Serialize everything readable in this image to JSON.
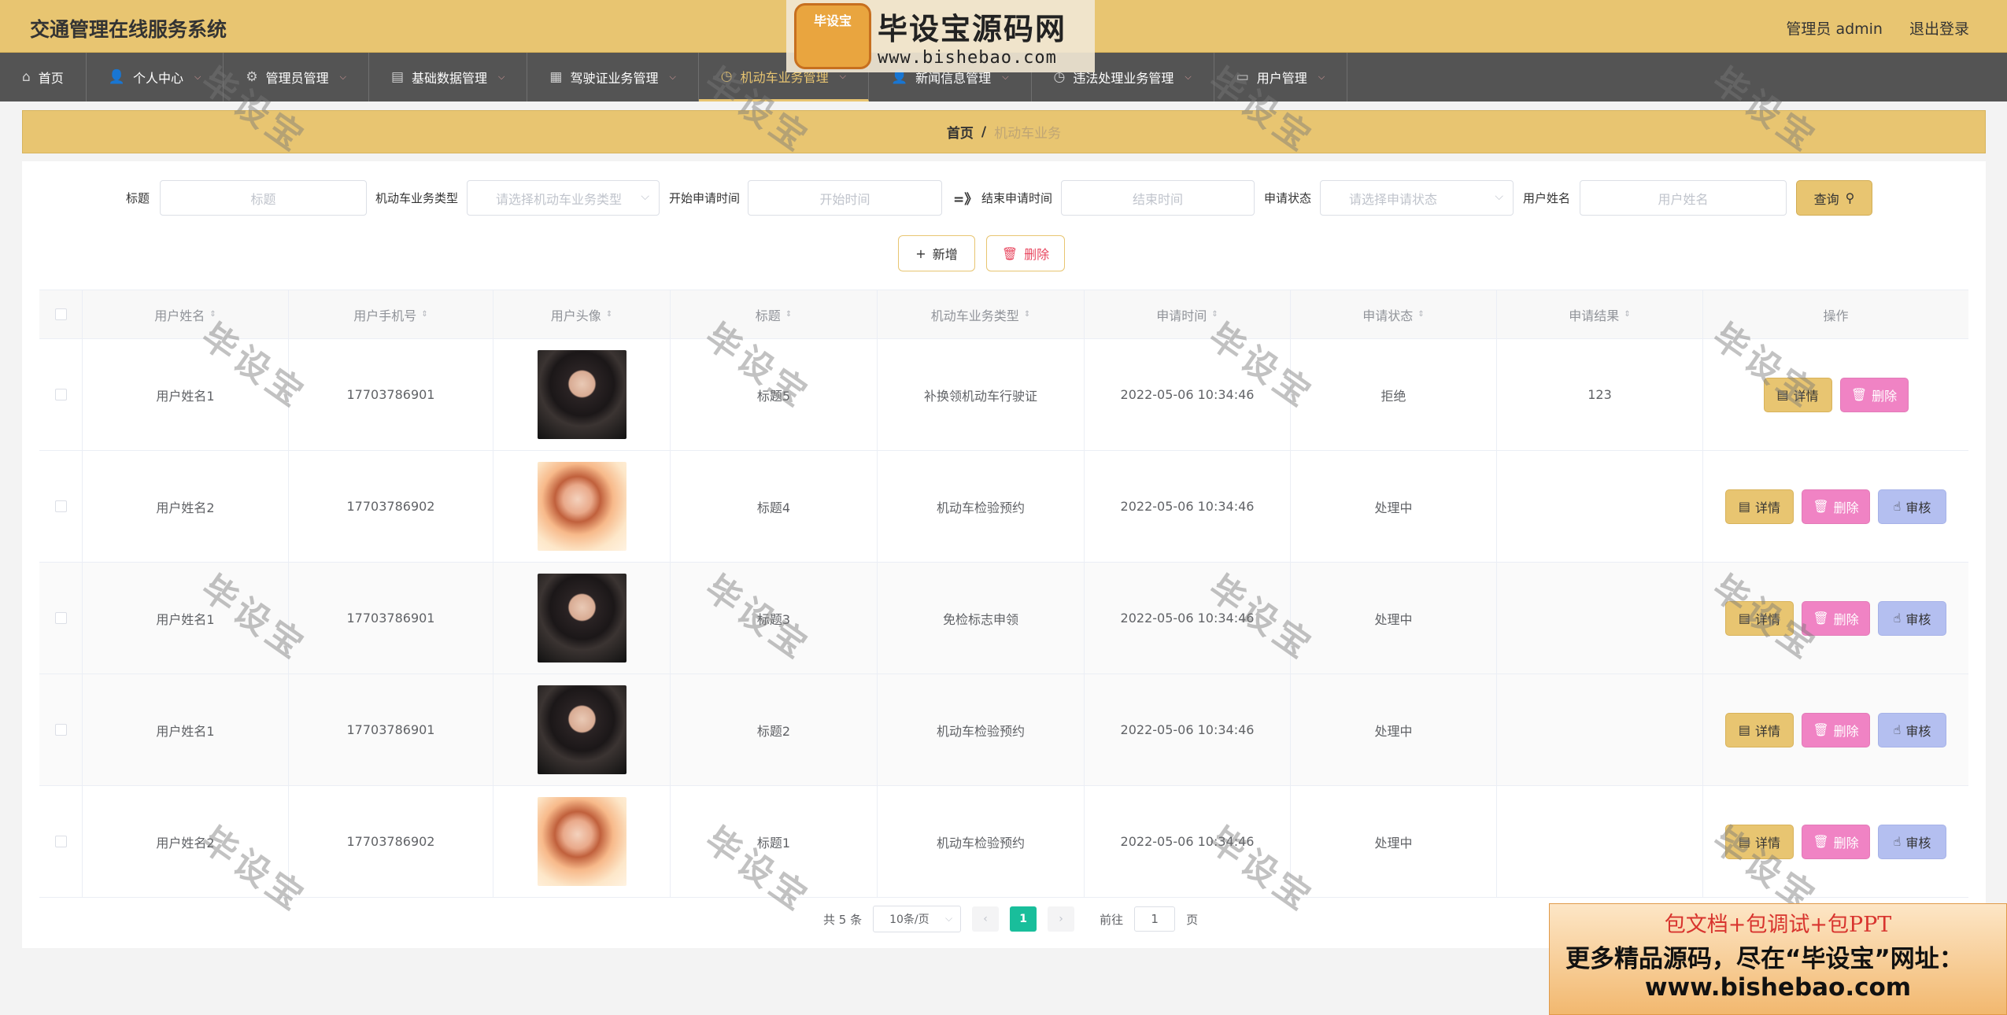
{
  "app": {
    "title": "交通管理在线服务系统"
  },
  "header": {
    "user_label": "管理员 admin",
    "logout_label": "退出登录"
  },
  "nav": {
    "items": [
      {
        "label": "首页",
        "icon": "home-icon"
      },
      {
        "label": "个人中心",
        "icon": "user-icon"
      },
      {
        "label": "管理员管理",
        "icon": "admin-icon"
      },
      {
        "label": "基础数据管理",
        "icon": "clipboard-icon"
      },
      {
        "label": "驾驶证业务管理",
        "icon": "grid-icon"
      },
      {
        "label": "机动车业务管理",
        "icon": "clock-icon",
        "active": true
      },
      {
        "label": "新闻信息管理",
        "icon": "user-icon"
      },
      {
        "label": "违法处理业务管理",
        "icon": "clock-icon"
      },
      {
        "label": "用户管理",
        "icon": "card-icon"
      }
    ]
  },
  "breadcrumb": {
    "home": "首页",
    "separator": "/",
    "current": "机动车业务"
  },
  "search": {
    "title_label": "标题",
    "title_placeholder": "标题",
    "type_label": "机动车业务类型",
    "type_placeholder": "请选择机动车业务类型",
    "start_label": "开始申请时间",
    "start_placeholder": "开始时间",
    "range_arrow": "=》",
    "end_label": "结束申请时间",
    "end_placeholder": "结束时间",
    "status_label": "申请状态",
    "status_placeholder": "请选择申请状态",
    "user_label": "用户姓名",
    "user_placeholder": "用户姓名",
    "query_label": "查询"
  },
  "actions": {
    "add_label": "新增",
    "delete_label": "删除"
  },
  "table": {
    "headers": [
      "用户姓名",
      "用户手机号",
      "用户头像",
      "标题",
      "机动车业务类型",
      "申请时间",
      "申请状态",
      "申请结果",
      "操作"
    ],
    "rows": [
      {
        "name": "用户姓名1",
        "phone": "17703786901",
        "avatar": "dark",
        "title": "标题5",
        "type": "补换领机动车行驶证",
        "time": "2022-05-06 10:34:46",
        "status": "拒绝",
        "result": "123",
        "audit": false
      },
      {
        "name": "用户姓名2",
        "phone": "17703786902",
        "avatar": "warm",
        "title": "标题4",
        "type": "机动车检验预约",
        "time": "2022-05-06 10:34:46",
        "status": "处理中",
        "result": "",
        "audit": true
      },
      {
        "name": "用户姓名1",
        "phone": "17703786901",
        "avatar": "dark",
        "title": "标题3",
        "type": "免检标志申领",
        "time": "2022-05-06 10:34:46",
        "status": "处理中",
        "result": "",
        "audit": true
      },
      {
        "name": "用户姓名1",
        "phone": "17703786901",
        "avatar": "dark",
        "title": "标题2",
        "type": "机动车检验预约",
        "time": "2022-05-06 10:34:46",
        "status": "处理中",
        "result": "",
        "audit": true
      },
      {
        "name": "用户姓名2",
        "phone": "17703786902",
        "avatar": "warm",
        "title": "标题1",
        "type": "机动车检验预约",
        "time": "2022-05-06 10:34:46",
        "status": "处理中",
        "result": "",
        "audit": true
      }
    ],
    "op_labels": {
      "detail": "详情",
      "delete": "删除",
      "audit": "审核"
    }
  },
  "pagination": {
    "total": "共 5 条",
    "page_size": "10条/页",
    "current_page": "1",
    "goto_label": "前往",
    "goto_value": "1",
    "page_unit": "页"
  },
  "watermark": {
    "text": "毕设宝",
    "logo_badge": "毕设宝",
    "logo_main": "毕设宝源码网",
    "logo_url": "www.bishebao.com",
    "promo_line1": "包文档+包调试+包PPT",
    "promo_line2": "更多精品源码，尽在“毕设宝”网址：",
    "promo_line3": "www.bishebao.com"
  },
  "colors": {
    "accent": "#e8c571",
    "nav_bg": "#545454",
    "pager_active": "#19be9b",
    "delete": "#f083c4",
    "audit": "#b4bff0"
  }
}
